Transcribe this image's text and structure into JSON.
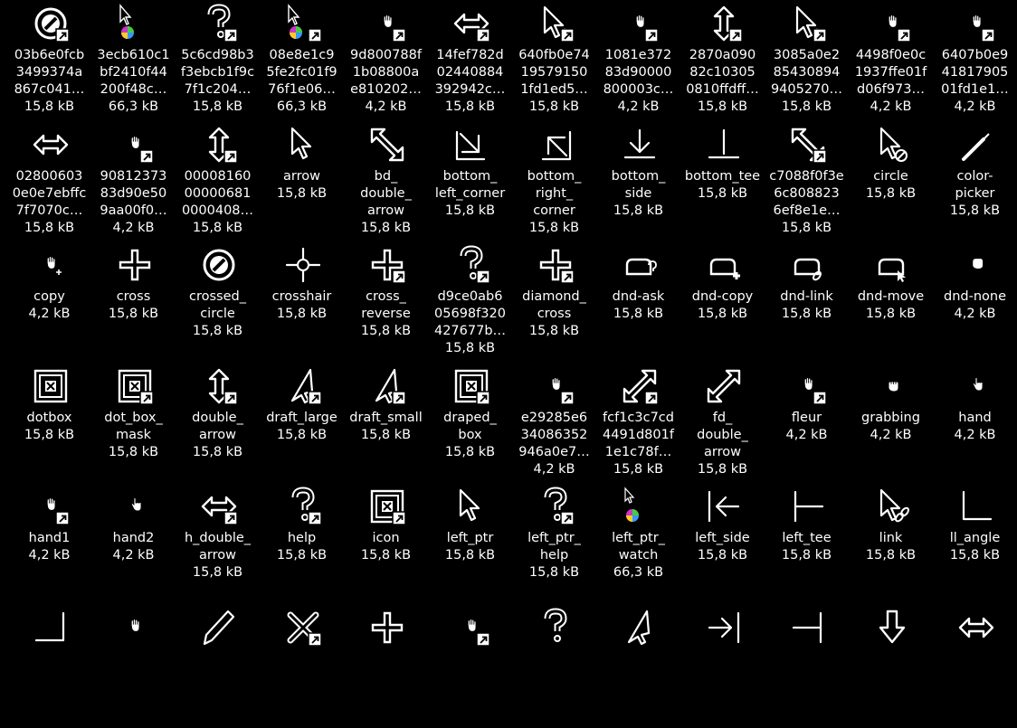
{
  "icons": [
    {
      "name": "03b6e0fcb\n3499374a\n867c041…",
      "size": "15,8 kB",
      "icon": "crossed-circle-icon",
      "link": true
    },
    {
      "name": "3ecb610c1\nbf2410f44\n200f48c…",
      "size": "66,3 kB",
      "icon": "arrow-watch-icon",
      "link": false
    },
    {
      "name": "5c6cd98b3\nf3ebcb1f9c\n7f1c204…",
      "size": "15,8 kB",
      "icon": "help-icon",
      "link": true
    },
    {
      "name": "08e8e1c9\n5fe2fc01f9\n76f1e06…",
      "size": "66,3 kB",
      "icon": "arrow-watch-icon",
      "link": true
    },
    {
      "name": "9d800788f\n1b08800a\ne810202…",
      "size": "4,2 kB",
      "icon": "small-hand-icon",
      "link": true
    },
    {
      "name": "14fef782d\n02440884\n392942c…",
      "size": "15,8 kB",
      "icon": "h-double-arrow-icon",
      "link": true
    },
    {
      "name": "640fb0e74\n19579150\n1fd1ed5…",
      "size": "15,8 kB",
      "icon": "arrow-copy-icon",
      "link": true
    },
    {
      "name": "1081e372\n83d90000\n800003c…",
      "size": "4,2 kB",
      "icon": "small-hand-icon",
      "link": true
    },
    {
      "name": "2870a090\n82c10305\n0810ffdff…",
      "size": "15,8 kB",
      "icon": "v-double-arrow-icon",
      "link": true
    },
    {
      "name": "3085a0e2\n85430894\n9405270…",
      "size": "15,8 kB",
      "icon": "arrow-copy-icon",
      "link": true
    },
    {
      "name": "4498f0e0c\n1937ffe01f\nd06f973…",
      "size": "4,2 kB",
      "icon": "small-hand-icon",
      "link": true
    },
    {
      "name": "6407b0e9\n41817905\n01fd1e1…",
      "size": "4,2 kB",
      "icon": "small-hand-icon",
      "link": true
    },
    {
      "name": "02800603\n0e0e7ebffc\n7f7070c…",
      "size": "15,8 kB",
      "icon": "h-double-arrow-icon",
      "link": false
    },
    {
      "name": "90812373\n83d90e50\n9aa00f0…",
      "size": "4,2 kB",
      "icon": "small-hand-icon",
      "link": true
    },
    {
      "name": "00008160\n00000681\n0000408…",
      "size": "15,8 kB",
      "icon": "v-double-arrow-icon",
      "link": true
    },
    {
      "name": "arrow",
      "size": "15,8 kB",
      "icon": "arrow-icon",
      "link": false
    },
    {
      "name": "bd_\ndouble_\narrow",
      "size": "15,8 kB",
      "icon": "bd-double-arrow-icon",
      "link": false
    },
    {
      "name": "bottom_\nleft_corner",
      "size": "15,8 kB",
      "icon": "bottom-left-corner-icon",
      "link": false
    },
    {
      "name": "bottom_\nright_\ncorner",
      "size": "15,8 kB",
      "icon": "bottom-right-corner-icon",
      "link": false
    },
    {
      "name": "bottom_\nside",
      "size": "15,8 kB",
      "icon": "bottom-side-icon",
      "link": false
    },
    {
      "name": "bottom_tee",
      "size": "15,8 kB",
      "icon": "bottom-tee-icon",
      "link": false
    },
    {
      "name": "c7088f0f3e\n6c808823\n6ef8e1e…",
      "size": "15,8 kB",
      "icon": "bd-double-arrow-icon",
      "link": true
    },
    {
      "name": "circle",
      "size": "15,8 kB",
      "icon": "arrow-circle-icon",
      "link": false
    },
    {
      "name": "color-\npicker",
      "size": "15,8 kB",
      "icon": "color-picker-icon",
      "link": false
    },
    {
      "name": "copy",
      "size": "4,2 kB",
      "icon": "small-hand-plus-icon",
      "link": false
    },
    {
      "name": "cross",
      "size": "15,8 kB",
      "icon": "cross-icon",
      "link": false
    },
    {
      "name": "crossed_\ncircle",
      "size": "15,8 kB",
      "icon": "crossed-circle-icon",
      "link": false
    },
    {
      "name": "crosshair",
      "size": "15,8 kB",
      "icon": "crosshair-icon",
      "link": false
    },
    {
      "name": "cross_\nreverse",
      "size": "15,8 kB",
      "icon": "cross-icon",
      "link": true
    },
    {
      "name": "d9ce0ab6\n05698f320\n427677b…",
      "size": "15,8 kB",
      "icon": "help-icon",
      "link": true
    },
    {
      "name": "diamond_\ncross",
      "size": "15,8 kB",
      "icon": "cross-icon",
      "link": true
    },
    {
      "name": "dnd-ask",
      "size": "15,8 kB",
      "icon": "dnd-ask-icon",
      "link": false
    },
    {
      "name": "dnd-copy",
      "size": "15,8 kB",
      "icon": "dnd-copy-icon",
      "link": false
    },
    {
      "name": "dnd-link",
      "size": "15,8 kB",
      "icon": "dnd-link-icon",
      "link": false
    },
    {
      "name": "dnd-move",
      "size": "15,8 kB",
      "icon": "dnd-move-icon",
      "link": false
    },
    {
      "name": "dnd-none",
      "size": "4,2 kB",
      "icon": "dnd-none-icon",
      "link": false
    },
    {
      "name": "dotbox",
      "size": "15,8 kB",
      "icon": "dotbox-icon",
      "link": false
    },
    {
      "name": "dot_box_\nmask",
      "size": "15,8 kB",
      "icon": "dotbox-icon",
      "link": true
    },
    {
      "name": "double_\narrow",
      "size": "15,8 kB",
      "icon": "v-double-arrow-icon",
      "link": true
    },
    {
      "name": "draft_large",
      "size": "15,8 kB",
      "icon": "draft-icon",
      "link": true
    },
    {
      "name": "draft_small",
      "size": "15,8 kB",
      "icon": "draft-icon",
      "link": true
    },
    {
      "name": "draped_\nbox",
      "size": "15,8 kB",
      "icon": "dotbox-icon",
      "link": true
    },
    {
      "name": "e29285e6\n34086352\n946a0e7…",
      "size": "4,2 kB",
      "icon": "small-hand-icon",
      "link": true
    },
    {
      "name": "fcf1c3c7cd\n4491d801f\n1e1c78f…",
      "size": "15,8 kB",
      "icon": "fd-double-arrow-icon",
      "link": true
    },
    {
      "name": "fd_\ndouble_\narrow",
      "size": "15,8 kB",
      "icon": "fd-double-arrow-icon",
      "link": false
    },
    {
      "name": "fleur",
      "size": "4,2 kB",
      "icon": "small-hand-icon",
      "link": true
    },
    {
      "name": "grabbing",
      "size": "4,2 kB",
      "icon": "grabbing-icon",
      "link": false
    },
    {
      "name": "hand",
      "size": "4,2 kB",
      "icon": "pointing-hand-icon",
      "link": false
    },
    {
      "name": "hand1",
      "size": "4,2 kB",
      "icon": "small-hand-icon",
      "link": true
    },
    {
      "name": "hand2",
      "size": "4,2 kB",
      "icon": "pointing-hand-icon",
      "link": false
    },
    {
      "name": "h_double_\narrow",
      "size": "15,8 kB",
      "icon": "h-double-arrow-icon",
      "link": true
    },
    {
      "name": "help",
      "size": "15,8 kB",
      "icon": "help-icon",
      "link": true
    },
    {
      "name": "icon",
      "size": "15,8 kB",
      "icon": "dotbox-icon",
      "link": true
    },
    {
      "name": "left_ptr",
      "size": "15,8 kB",
      "icon": "arrow-icon",
      "link": false
    },
    {
      "name": "left_ptr_\nhelp",
      "size": "15,8 kB",
      "icon": "help-icon",
      "link": true
    },
    {
      "name": "left_ptr_\nwatch",
      "size": "66,3 kB",
      "icon": "small-arrow-watch-icon",
      "link": false
    },
    {
      "name": "left_side",
      "size": "15,8 kB",
      "icon": "left-side-icon",
      "link": false
    },
    {
      "name": "left_tee",
      "size": "15,8 kB",
      "icon": "left-tee-icon",
      "link": false
    },
    {
      "name": "link",
      "size": "15,8 kB",
      "icon": "arrow-link-icon",
      "link": false
    },
    {
      "name": "ll_angle",
      "size": "15,8 kB",
      "icon": "ll-angle-icon",
      "link": false
    },
    {
      "name": "",
      "size": "",
      "icon": "lr-angle-icon",
      "link": false
    },
    {
      "name": "",
      "size": "",
      "icon": "small-hand-icon",
      "link": false
    },
    {
      "name": "",
      "size": "",
      "icon": "pencil-icon",
      "link": false
    },
    {
      "name": "",
      "size": "",
      "icon": "pirate-icon",
      "link": true
    },
    {
      "name": "",
      "size": "",
      "icon": "plus-icon",
      "link": false
    },
    {
      "name": "",
      "size": "",
      "icon": "small-hand-icon",
      "link": true
    },
    {
      "name": "",
      "size": "",
      "icon": "help-icon",
      "link": false
    },
    {
      "name": "",
      "size": "",
      "icon": "draft-icon",
      "link": false
    },
    {
      "name": "",
      "size": "",
      "icon": "right-side-icon",
      "link": false
    },
    {
      "name": "",
      "size": "",
      "icon": "right-tee-icon",
      "link": false
    },
    {
      "name": "",
      "size": "",
      "icon": "down-arrow-icon",
      "link": false
    },
    {
      "name": "",
      "size": "",
      "icon": "h-double-arrow-icon",
      "link": false
    }
  ]
}
